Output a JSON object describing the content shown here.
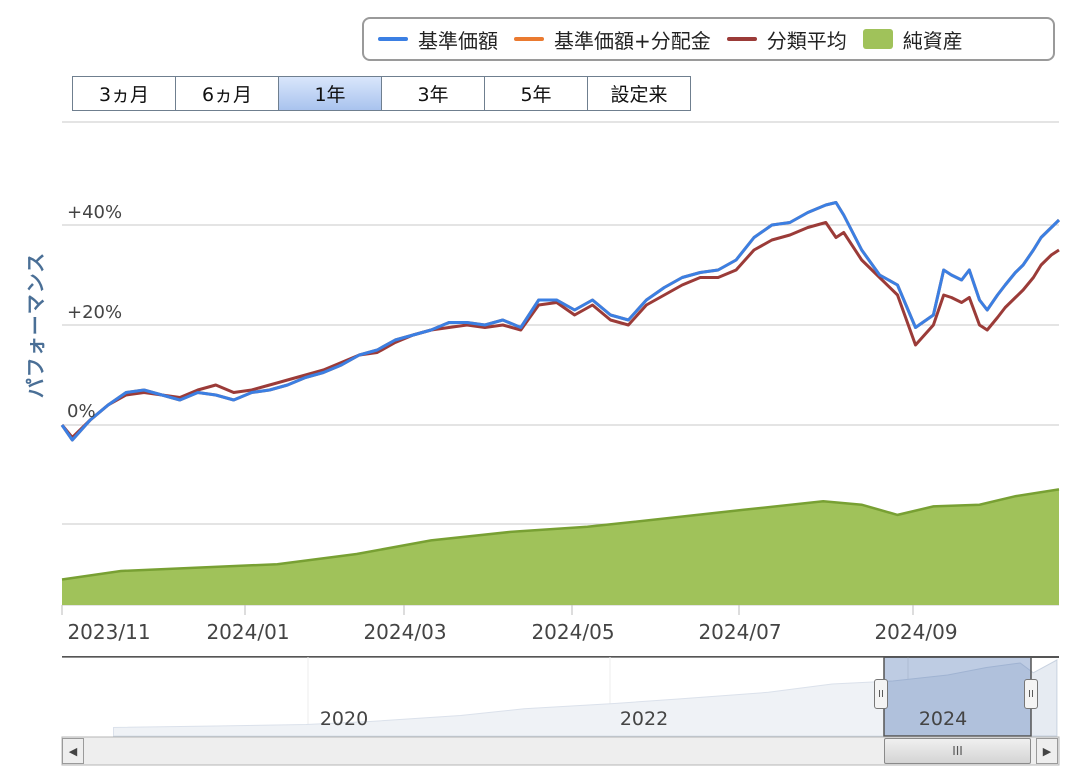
{
  "legend": [
    {
      "label": "基準価額",
      "kind": "line",
      "color": "#3b7fe3"
    },
    {
      "label": "基準価額+分配金",
      "kind": "line",
      "color": "#ea7a30"
    },
    {
      "label": "分類平均",
      "kind": "line",
      "color": "#9b3b38"
    },
    {
      "label": "純資産",
      "kind": "area",
      "color": "#a0c25a"
    }
  ],
  "ranges": [
    {
      "label": "3ヵ月",
      "active": false
    },
    {
      "label": "6ヵ月",
      "active": false
    },
    {
      "label": "1年",
      "active": true
    },
    {
      "label": "3年",
      "active": false
    },
    {
      "label": "5年",
      "active": false
    },
    {
      "label": "設定来",
      "active": false
    }
  ],
  "navigator": {
    "year_labels": [
      "2020",
      "2022",
      "2024"
    ],
    "thumb_grip": "III",
    "handle_grip": "II"
  },
  "chart_data": {
    "type": "line",
    "ylabel": "パフォーマンス",
    "y_ticks": [
      "+40%",
      "+20%",
      "0%"
    ],
    "ylim": [
      -10,
      52
    ],
    "x_ticks": [
      "2023/11",
      "2024/01",
      "2024/03",
      "2024/05",
      "2024/07",
      "2024/09"
    ],
    "x_range": [
      "2023-10-23",
      "2024-11-15"
    ],
    "grid": true,
    "legend_position": "top-right",
    "series": [
      {
        "name": "基準価額",
        "color": "#3b7fe3",
        "points": [
          [
            "2023-10-23",
            0
          ],
          [
            "2023-10-27",
            -3
          ],
          [
            "2023-11-03",
            1
          ],
          [
            "2023-11-10",
            4
          ],
          [
            "2023-11-17",
            6.5
          ],
          [
            "2023-11-24",
            7
          ],
          [
            "2023-12-01",
            6
          ],
          [
            "2023-12-08",
            5
          ],
          [
            "2023-12-15",
            6.5
          ],
          [
            "2023-12-22",
            6
          ],
          [
            "2023-12-29",
            5
          ],
          [
            "2024-01-05",
            6.5
          ],
          [
            "2024-01-12",
            7
          ],
          [
            "2024-01-19",
            8
          ],
          [
            "2024-01-26",
            9.5
          ],
          [
            "2024-02-02",
            10.5
          ],
          [
            "2024-02-09",
            12
          ],
          [
            "2024-02-16",
            14
          ],
          [
            "2024-02-23",
            15
          ],
          [
            "2024-03-01",
            17
          ],
          [
            "2024-03-08",
            18
          ],
          [
            "2024-03-15",
            19
          ],
          [
            "2024-03-22",
            20.5
          ],
          [
            "2024-03-29",
            20.5
          ],
          [
            "2024-04-05",
            20
          ],
          [
            "2024-04-12",
            21
          ],
          [
            "2024-04-19",
            19.5
          ],
          [
            "2024-04-26",
            25
          ],
          [
            "2024-05-03",
            25
          ],
          [
            "2024-05-10",
            23
          ],
          [
            "2024-05-17",
            25
          ],
          [
            "2024-05-24",
            22
          ],
          [
            "2024-05-31",
            21
          ],
          [
            "2024-06-07",
            25
          ],
          [
            "2024-06-14",
            27.5
          ],
          [
            "2024-06-21",
            29.5
          ],
          [
            "2024-06-28",
            30.5
          ],
          [
            "2024-07-05",
            31
          ],
          [
            "2024-07-12",
            33
          ],
          [
            "2024-07-19",
            37.5
          ],
          [
            "2024-07-26",
            40
          ],
          [
            "2024-08-02",
            40.5
          ],
          [
            "2024-08-09",
            42.5
          ],
          [
            "2024-08-16",
            44
          ],
          [
            "2024-08-20",
            44.5
          ],
          [
            "2024-08-23",
            42
          ],
          [
            "2024-08-30",
            35
          ],
          [
            "2024-09-06",
            30
          ],
          [
            "2024-09-13",
            28
          ],
          [
            "2024-09-20",
            19.5
          ],
          [
            "2024-09-27",
            22
          ],
          [
            "2024-10-01",
            31
          ],
          [
            "2024-10-04",
            30
          ],
          [
            "2024-10-08",
            29
          ],
          [
            "2024-10-11",
            31
          ],
          [
            "2024-10-15",
            25
          ],
          [
            "2024-10-18",
            23
          ],
          [
            "2024-10-22",
            26
          ],
          [
            "2024-10-25",
            28
          ],
          [
            "2024-10-29",
            30.5
          ],
          [
            "2024-11-01",
            32
          ],
          [
            "2024-11-05",
            35
          ],
          [
            "2024-11-08",
            37.5
          ],
          [
            "2024-11-12",
            39.5
          ],
          [
            "2024-11-15",
            41
          ]
        ]
      },
      {
        "name": "基準価額+分配金",
        "color": "#ea7a30",
        "points": [
          [
            "2023-10-23",
            0
          ],
          [
            "2023-10-27",
            -3
          ],
          [
            "2023-11-03",
            1
          ],
          [
            "2023-11-10",
            4
          ],
          [
            "2023-11-17",
            6.5
          ],
          [
            "2023-11-24",
            7
          ],
          [
            "2023-12-01",
            6
          ],
          [
            "2023-12-08",
            5
          ],
          [
            "2023-12-15",
            6.5
          ],
          [
            "2023-12-22",
            6
          ],
          [
            "2023-12-29",
            5
          ],
          [
            "2024-01-05",
            6.5
          ],
          [
            "2024-01-12",
            7
          ],
          [
            "2024-01-19",
            8
          ],
          [
            "2024-01-26",
            9.5
          ],
          [
            "2024-02-02",
            10.5
          ],
          [
            "2024-02-09",
            12
          ],
          [
            "2024-02-16",
            14
          ],
          [
            "2024-02-23",
            15
          ],
          [
            "2024-03-01",
            17
          ],
          [
            "2024-03-08",
            18
          ],
          [
            "2024-03-15",
            19
          ],
          [
            "2024-03-22",
            20.5
          ],
          [
            "2024-03-29",
            20.5
          ],
          [
            "2024-04-05",
            20
          ],
          [
            "2024-04-12",
            21
          ],
          [
            "2024-04-19",
            19.5
          ],
          [
            "2024-04-26",
            25
          ],
          [
            "2024-05-03",
            25
          ],
          [
            "2024-05-10",
            23
          ],
          [
            "2024-05-17",
            25
          ],
          [
            "2024-05-24",
            22
          ],
          [
            "2024-05-31",
            21
          ],
          [
            "2024-06-07",
            25
          ],
          [
            "2024-06-14",
            27.5
          ],
          [
            "2024-06-21",
            29.5
          ],
          [
            "2024-06-28",
            30.5
          ],
          [
            "2024-07-05",
            31
          ],
          [
            "2024-07-12",
            33
          ],
          [
            "2024-07-19",
            37.5
          ],
          [
            "2024-07-26",
            40
          ],
          [
            "2024-08-02",
            40.5
          ],
          [
            "2024-08-09",
            42.5
          ],
          [
            "2024-08-16",
            44
          ],
          [
            "2024-08-20",
            44.5
          ],
          [
            "2024-08-23",
            42
          ],
          [
            "2024-08-30",
            35
          ],
          [
            "2024-09-06",
            30
          ],
          [
            "2024-09-13",
            28
          ],
          [
            "2024-09-20",
            19.5
          ],
          [
            "2024-09-27",
            22
          ],
          [
            "2024-10-01",
            31
          ],
          [
            "2024-10-04",
            30
          ],
          [
            "2024-10-08",
            29
          ],
          [
            "2024-10-11",
            31
          ],
          [
            "2024-10-15",
            25
          ],
          [
            "2024-10-18",
            23
          ],
          [
            "2024-10-22",
            26
          ],
          [
            "2024-10-25",
            28
          ],
          [
            "2024-10-29",
            30.5
          ],
          [
            "2024-11-01",
            32
          ],
          [
            "2024-11-05",
            35
          ],
          [
            "2024-11-08",
            37.5
          ],
          [
            "2024-11-12",
            39.5
          ],
          [
            "2024-11-15",
            41
          ]
        ]
      },
      {
        "name": "分類平均",
        "color": "#9b3b38",
        "points": [
          [
            "2023-10-23",
            0
          ],
          [
            "2023-10-27",
            -2.5
          ],
          [
            "2023-11-03",
            1
          ],
          [
            "2023-11-10",
            4
          ],
          [
            "2023-11-17",
            6
          ],
          [
            "2023-11-24",
            6.5
          ],
          [
            "2023-12-01",
            6
          ],
          [
            "2023-12-08",
            5.5
          ],
          [
            "2023-12-15",
            7
          ],
          [
            "2023-12-22",
            8
          ],
          [
            "2023-12-29",
            6.5
          ],
          [
            "2024-01-05",
            7
          ],
          [
            "2024-01-12",
            8
          ],
          [
            "2024-01-19",
            9
          ],
          [
            "2024-01-26",
            10
          ],
          [
            "2024-02-02",
            11
          ],
          [
            "2024-02-09",
            12.5
          ],
          [
            "2024-02-16",
            14
          ],
          [
            "2024-02-23",
            14.5
          ],
          [
            "2024-03-01",
            16.5
          ],
          [
            "2024-03-08",
            18
          ],
          [
            "2024-03-15",
            19
          ],
          [
            "2024-03-22",
            19.5
          ],
          [
            "2024-03-29",
            20
          ],
          [
            "2024-04-05",
            19.5
          ],
          [
            "2024-04-12",
            20
          ],
          [
            "2024-04-19",
            19
          ],
          [
            "2024-04-26",
            24
          ],
          [
            "2024-05-03",
            24.5
          ],
          [
            "2024-05-10",
            22
          ],
          [
            "2024-05-17",
            24
          ],
          [
            "2024-05-24",
            21
          ],
          [
            "2024-05-31",
            20
          ],
          [
            "2024-06-07",
            24
          ],
          [
            "2024-06-14",
            26
          ],
          [
            "2024-06-21",
            28
          ],
          [
            "2024-06-28",
            29.5
          ],
          [
            "2024-07-05",
            29.5
          ],
          [
            "2024-07-12",
            31
          ],
          [
            "2024-07-19",
            35
          ],
          [
            "2024-07-26",
            37
          ],
          [
            "2024-08-02",
            38
          ],
          [
            "2024-08-09",
            39.5
          ],
          [
            "2024-08-16",
            40.5
          ],
          [
            "2024-08-20",
            37.5
          ],
          [
            "2024-08-23",
            38.5
          ],
          [
            "2024-08-30",
            33
          ],
          [
            "2024-09-06",
            29.5
          ],
          [
            "2024-09-13",
            26
          ],
          [
            "2024-09-20",
            16
          ],
          [
            "2024-09-27",
            20
          ],
          [
            "2024-10-01",
            26
          ],
          [
            "2024-10-04",
            25.5
          ],
          [
            "2024-10-08",
            24.5
          ],
          [
            "2024-10-11",
            25.5
          ],
          [
            "2024-10-15",
            20
          ],
          [
            "2024-10-18",
            19
          ],
          [
            "2024-10-22",
            21.5
          ],
          [
            "2024-10-25",
            23.5
          ],
          [
            "2024-10-29",
            25.5
          ],
          [
            "2024-11-01",
            27
          ],
          [
            "2024-11-05",
            29.5
          ],
          [
            "2024-11-08",
            32
          ],
          [
            "2024-11-12",
            34
          ],
          [
            "2024-11-15",
            35
          ]
        ]
      }
    ],
    "net_assets": {
      "name": "純資産",
      "color": "#a0c25a",
      "points": [
        [
          "2023-10-23",
          0.15
        ],
        [
          "2023-11-15",
          0.2
        ],
        [
          "2023-12-15",
          0.22
        ],
        [
          "2024-01-15",
          0.24
        ],
        [
          "2024-02-15",
          0.3
        ],
        [
          "2024-03-15",
          0.38
        ],
        [
          "2024-04-15",
          0.43
        ],
        [
          "2024-05-15",
          0.46
        ],
        [
          "2024-06-15",
          0.51
        ],
        [
          "2024-07-15",
          0.56
        ],
        [
          "2024-08-15",
          0.61
        ],
        [
          "2024-08-30",
          0.59
        ],
        [
          "2024-09-13",
          0.53
        ],
        [
          "2024-09-27",
          0.58
        ],
        [
          "2024-10-15",
          0.59
        ],
        [
          "2024-10-29",
          0.64
        ],
        [
          "2024-11-15",
          0.68
        ]
      ]
    },
    "navigator_series": {
      "points": [
        [
          "2018-10-01",
          0.1
        ],
        [
          "2019-06-01",
          0.12
        ],
        [
          "2020-01-01",
          0.14
        ],
        [
          "2020-06-01",
          0.18
        ],
        [
          "2021-01-01",
          0.26
        ],
        [
          "2021-06-01",
          0.35
        ],
        [
          "2022-01-01",
          0.42
        ],
        [
          "2022-06-01",
          0.48
        ],
        [
          "2023-01-01",
          0.57
        ],
        [
          "2023-06-01",
          0.68
        ],
        [
          "2023-10-23",
          0.72
        ],
        [
          "2024-03-01",
          0.8
        ],
        [
          "2024-06-01",
          0.9
        ],
        [
          "2024-08-20",
          0.96
        ],
        [
          "2024-09-20",
          0.83
        ],
        [
          "2024-11-15",
          1.0
        ]
      ]
    }
  }
}
